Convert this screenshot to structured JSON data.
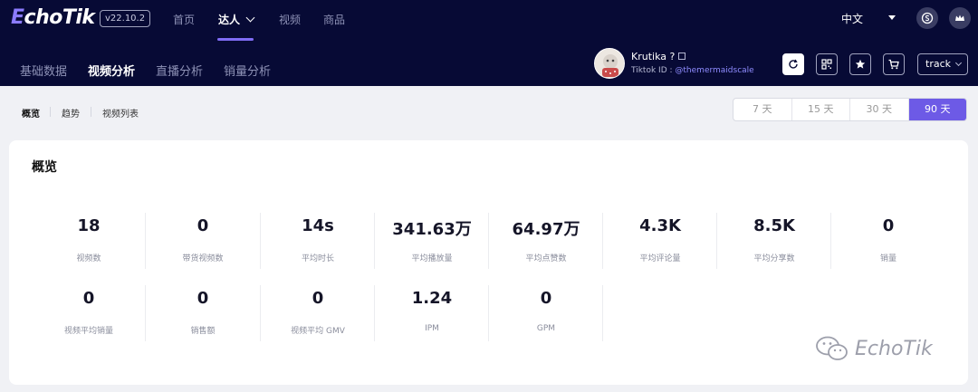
{
  "app": {
    "logo_prefix": "E",
    "logo_rest": "choTik",
    "version": "v22.10.2"
  },
  "topnav": {
    "items": [
      "首页",
      "达人",
      "视频",
      "商品"
    ],
    "active": "达人"
  },
  "language": "中文",
  "subnav": {
    "items": [
      "基础数据",
      "视频分析",
      "直播分析",
      "销量分析"
    ],
    "active": "视频分析"
  },
  "user": {
    "name": "Krutika ?",
    "id_label": "Tiktok ID :",
    "handle": "@themermaidscale"
  },
  "track_select": "track",
  "tabs": {
    "items": [
      "概览",
      "趋势",
      "视频列表"
    ],
    "active": "概览"
  },
  "ranges": {
    "items": [
      "7 天",
      "15 天",
      "30 天",
      "90 天"
    ],
    "active": "90 天"
  },
  "overview": {
    "title": "概览",
    "metrics": [
      {
        "value": "18",
        "label": "视频数"
      },
      {
        "value": "0",
        "label": "带货视频数"
      },
      {
        "value": "14s",
        "label": "平均时长"
      },
      {
        "value": "341.63万",
        "label": "平均播放量"
      },
      {
        "value": "64.97万",
        "label": "平均点赞数"
      },
      {
        "value": "4.3K",
        "label": "平均评论量"
      },
      {
        "value": "8.5K",
        "label": "平均分享数"
      },
      {
        "value": "0",
        "label": "销量"
      },
      {
        "value": "0",
        "label": "视频平均销量"
      },
      {
        "value": "0",
        "label": "销售额"
      },
      {
        "value": "0",
        "label": "视频平均 GMV"
      },
      {
        "value": "1.24",
        "label": "IPM"
      },
      {
        "value": "0",
        "label": "GPM"
      }
    ]
  },
  "watermark": "EchoTik",
  "colors": {
    "header_bg": "#070a35",
    "accent": "#6d5ae6",
    "page_bg": "#f0f1f5"
  }
}
